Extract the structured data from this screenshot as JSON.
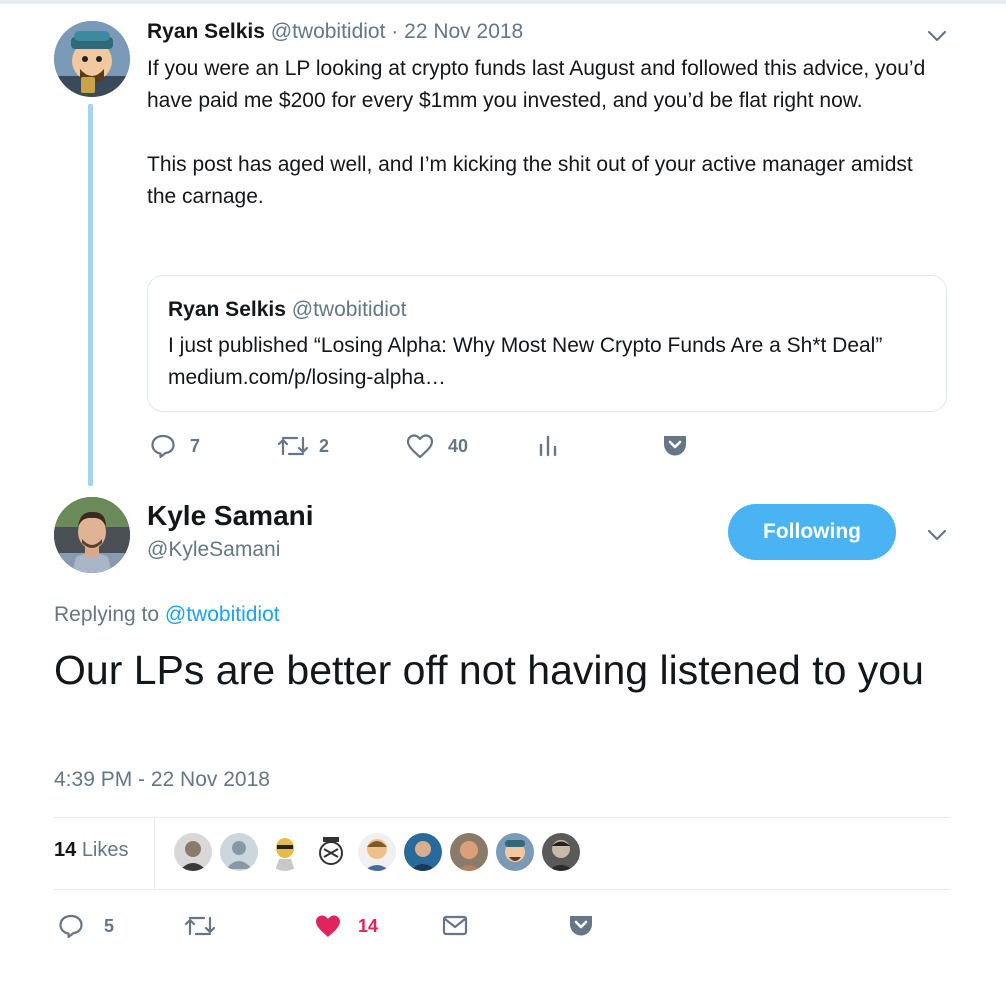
{
  "parent_tweet": {
    "author_name": "Ryan Selkis",
    "author_handle": "@twobitidiot",
    "separator": "·",
    "date": "22 Nov 2018",
    "text_p1": "If you were an LP looking at crypto funds last August and followed this advice, you’d have paid me $200 for every $1mm you invested, and you’d be flat right now.",
    "text_p2": "This post has aged well, and I’m kicking the shit out of your active manager amidst the carnage.",
    "quote": {
      "author_name": "Ryan Selkis",
      "author_handle": "@twobitidiot",
      "text": "I just published “Losing Alpha: Why Most New Crypto Funds Are a Sh*t Deal” medium.com/p/losing-alpha…"
    },
    "actions": {
      "replies": "7",
      "retweets": "2",
      "likes": "40"
    }
  },
  "main_tweet": {
    "author_name": "Kyle Samani",
    "author_handle": "@KyleSamani",
    "follow_label": "Following",
    "replying_prefix": "Replying to",
    "replying_handle": "@twobitidiot",
    "text": "Our LPs are better off not having listened to you",
    "timestamp": "4:39 PM - 22 Nov 2018",
    "likes_count": "14",
    "likes_label": "Likes",
    "likers": [
      "avatar-1",
      "avatar-2",
      "avatar-3",
      "avatar-4",
      "avatar-5",
      "avatar-6",
      "avatar-7",
      "avatar-8",
      "avatar-9"
    ],
    "actions": {
      "replies": "5",
      "likes": "14"
    }
  },
  "colors": {
    "accent": "#1da1f2",
    "follow_button": "#4ab3f4",
    "thread_line": "#a7d3f2",
    "like_active": "#e0245e",
    "secondary_text": "#657786"
  }
}
